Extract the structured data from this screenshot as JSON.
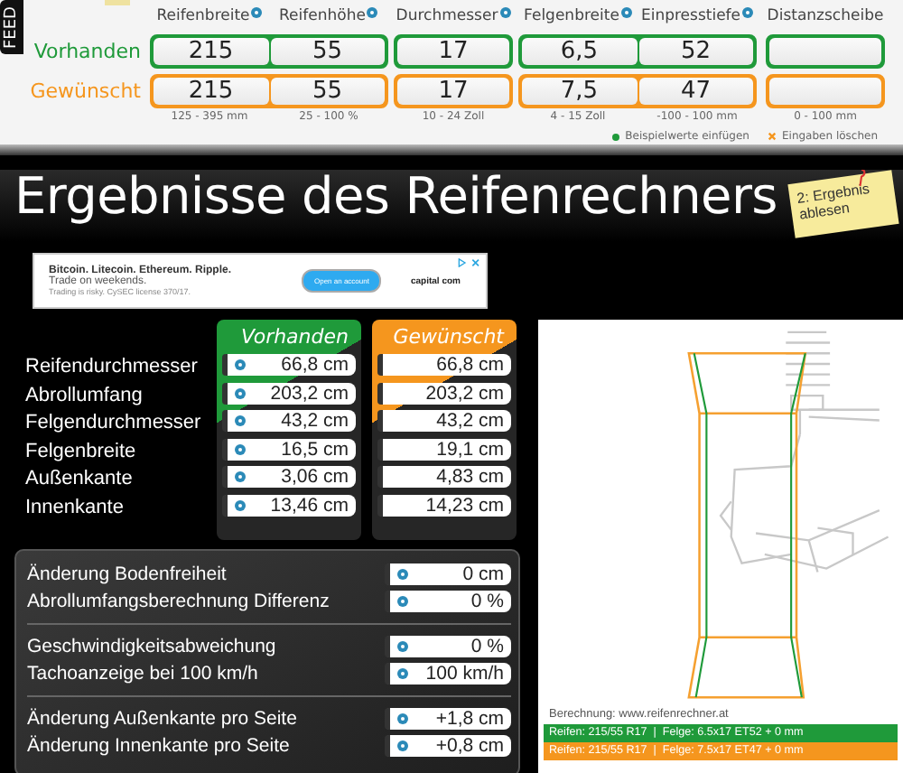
{
  "feedback_tab": {
    "label": "FEED"
  },
  "inputs": {
    "groups": [
      {
        "columns": [
          {
            "label": "Reifenbreite",
            "help": true,
            "range": "125 - 395 mm"
          },
          {
            "label": "Reifenhöhe",
            "help": true,
            "range": "25 - 100 %"
          }
        ]
      },
      {
        "columns": [
          {
            "label": "Durchmesser",
            "help": true,
            "range": "10 - 24 Zoll"
          }
        ]
      },
      {
        "columns": [
          {
            "label": "Felgenbreite",
            "help": true,
            "range": "4 - 15 Zoll"
          },
          {
            "label": "Einpresstiefe",
            "help": true,
            "range": "-100 - 100 mm"
          }
        ]
      },
      {
        "columns": [
          {
            "label": "Distanzscheibe",
            "help": false,
            "range": "0 - 100 mm"
          }
        ]
      }
    ],
    "rows": [
      {
        "label": "Vorhanden",
        "kind": "current",
        "values": [
          "215",
          "55",
          "17",
          "6,5",
          "52"
        ]
      },
      {
        "label": "Gewünscht",
        "kind": "desired",
        "values": [
          "215",
          "55",
          "17",
          "7,5",
          "47"
        ]
      }
    ],
    "actions": [
      {
        "label": "Beispielwerte einfügen",
        "kind": "fill"
      },
      {
        "label": "Eingaben löschen",
        "kind": "clear"
      }
    ]
  },
  "title": "Ergebnisse des Reifenrechners",
  "sticky_note": {
    "text": "2: Ergebnis ablesen"
  },
  "ad": {
    "headline": "Bitcoin. Litecoin. Ethereum. Ripple.",
    "subline": "Trade on weekends.",
    "disclaimer": "Trading is risky. CySEC license 370/17.",
    "button": "Open an account",
    "brand": "capital com"
  },
  "results": {
    "columns": [
      {
        "label": "Vorhanden",
        "kind": "current",
        "help": true
      },
      {
        "label": "Gewünscht",
        "kind": "desired",
        "help": false
      }
    ],
    "rows": [
      {
        "label": "Reifendurchmesser",
        "values": [
          "66,8 cm",
          "66,8 cm"
        ]
      },
      {
        "label": "Abrollumfang",
        "values": [
          "203,2 cm",
          "203,2 cm"
        ]
      },
      {
        "label": "Felgendurchmesser",
        "values": [
          "43,2 cm",
          "43,2 cm"
        ]
      },
      {
        "label": "Felgenbreite",
        "values": [
          "16,5 cm",
          "19,1 cm"
        ]
      },
      {
        "label": "Außenkante",
        "values": [
          "3,06 cm",
          "4,83 cm"
        ]
      },
      {
        "label": "Innenkante",
        "values": [
          "13,46 cm",
          "14,23 cm"
        ]
      }
    ]
  },
  "differences": [
    {
      "rows": [
        {
          "label": "Änderung Bodenfreiheit",
          "value": "0 cm"
        },
        {
          "label": "Abrollumfangsberechnung Differenz",
          "value": "0 %"
        }
      ]
    },
    {
      "rows": [
        {
          "label": "Geschwindigkeitsabweichung",
          "value": "0 %"
        },
        {
          "label": "Tachoanzeige bei 100 km/h",
          "value": "100 km/h"
        }
      ]
    },
    {
      "rows": [
        {
          "label": "Änderung Außenkante pro Seite",
          "value": "+1,8 cm"
        },
        {
          "label": "Änderung Innenkante pro Seite",
          "value": "+0,8 cm"
        }
      ]
    }
  ],
  "diagram": {
    "credit": "Berechnung: www.reifenrechner.at",
    "legend": [
      {
        "kind": "current",
        "text": "Reifen: 215/55 R17  |  Felge: 6.5x17 ET52 + 0 mm"
      },
      {
        "kind": "desired",
        "text": "Reifen: 215/55 R17  |  Felge: 7.5x17 ET47 + 0 mm"
      }
    ]
  }
}
